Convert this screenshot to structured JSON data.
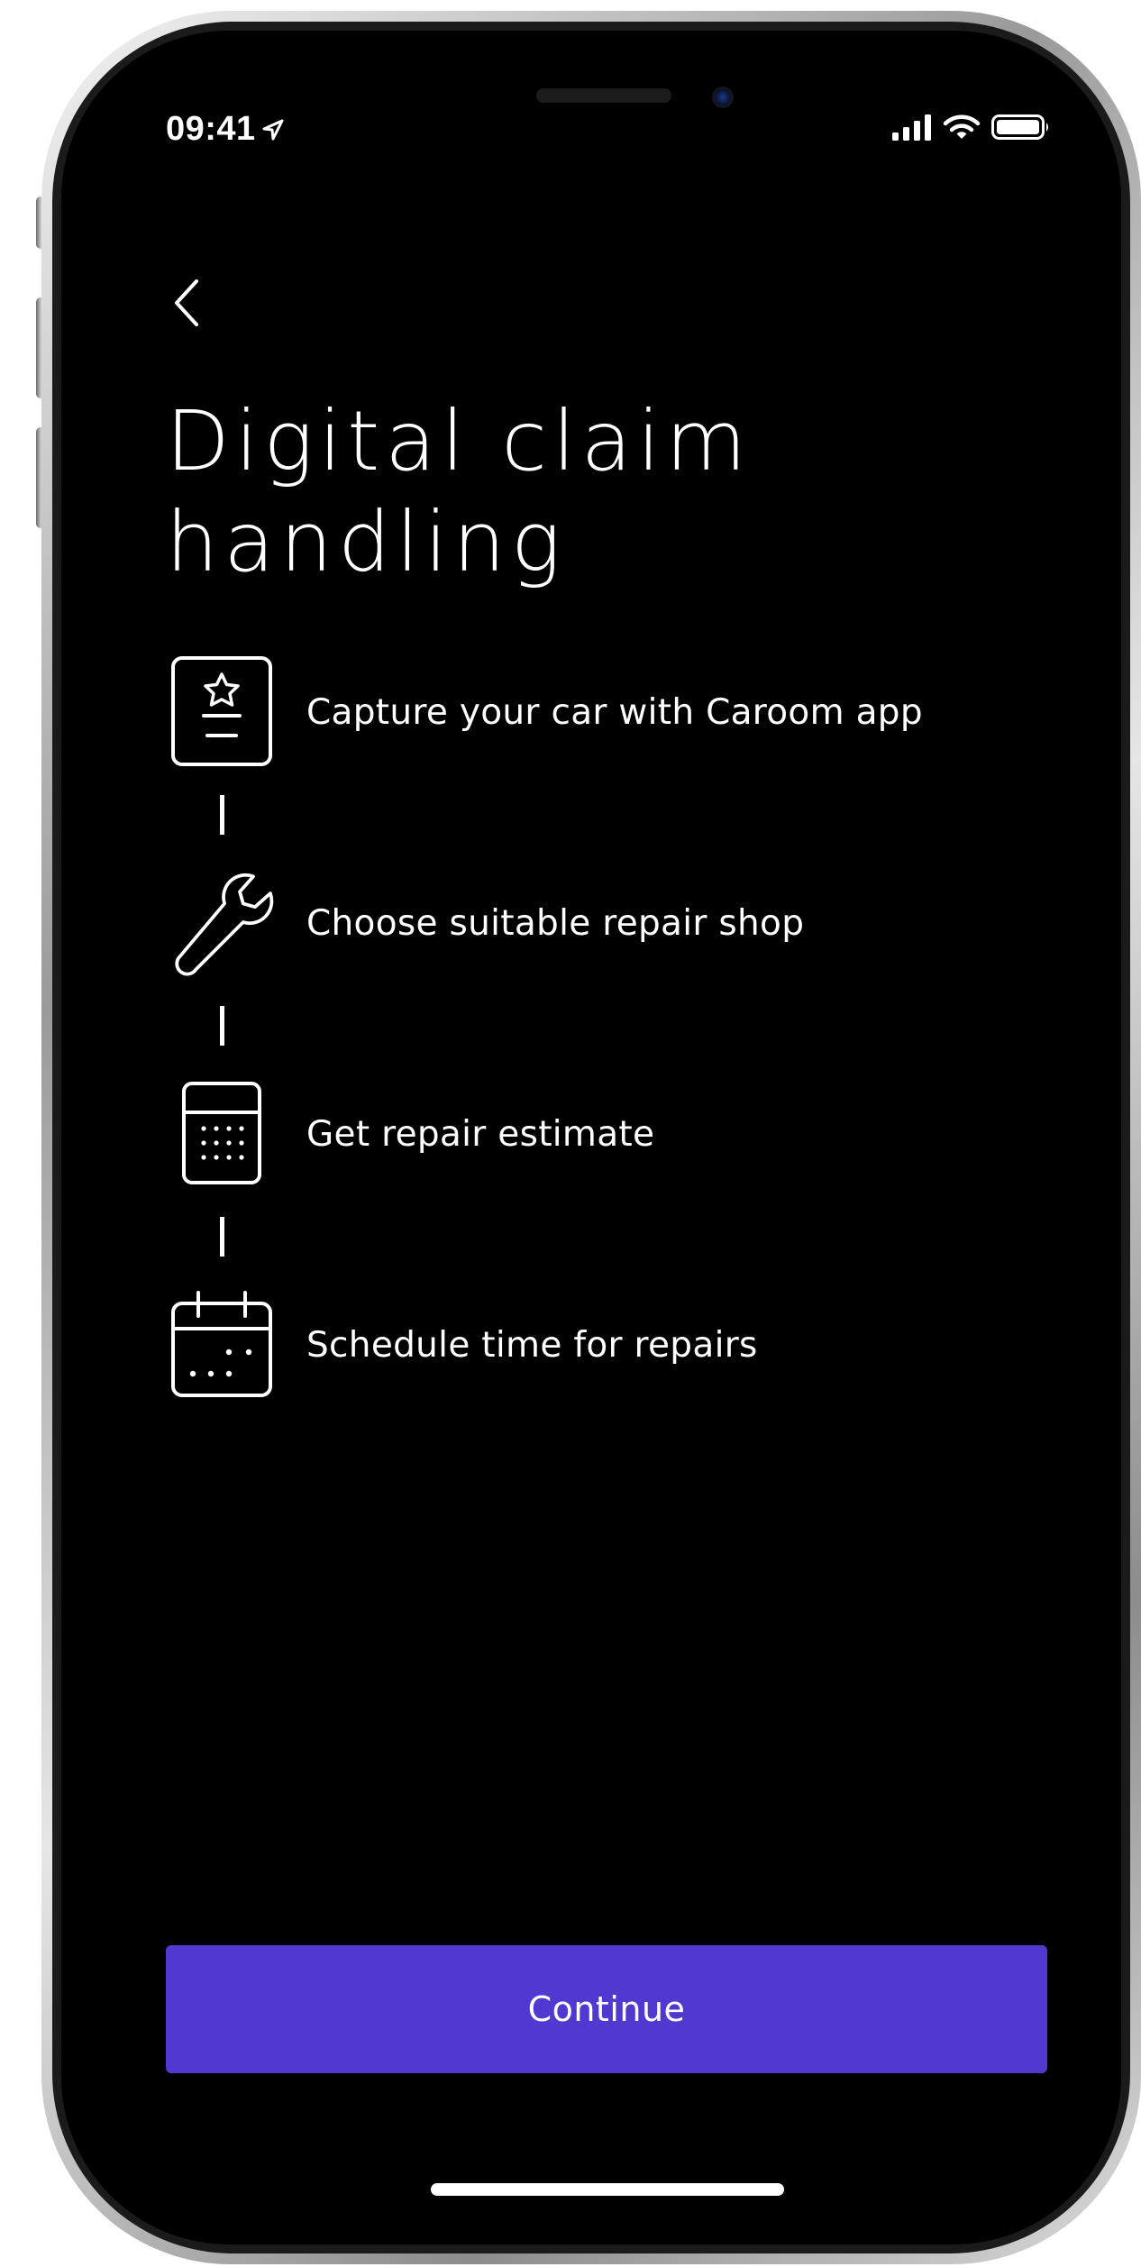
{
  "status_bar": {
    "time": "09:41",
    "location_icon": "location-arrow-icon",
    "signal_icon": "cellular-signal-icon",
    "wifi_icon": "wifi-icon",
    "battery_icon": "battery-icon"
  },
  "nav": {
    "back_icon": "chevron-left-icon"
  },
  "page": {
    "title_line1": "Digital claim",
    "title_line2": "handling"
  },
  "steps": [
    {
      "icon": "photo-card-star-icon",
      "label": "Capture your car with Caroom app"
    },
    {
      "icon": "wrench-icon",
      "label": "Choose suitable repair shop"
    },
    {
      "icon": "calculator-icon",
      "label": "Get repair estimate"
    },
    {
      "icon": "calendar-icon",
      "label": "Schedule time for repairs"
    }
  ],
  "cta": {
    "label": "Continue"
  },
  "colors": {
    "background": "#000000",
    "text": "#ffffff",
    "accent": "#5038d0"
  }
}
